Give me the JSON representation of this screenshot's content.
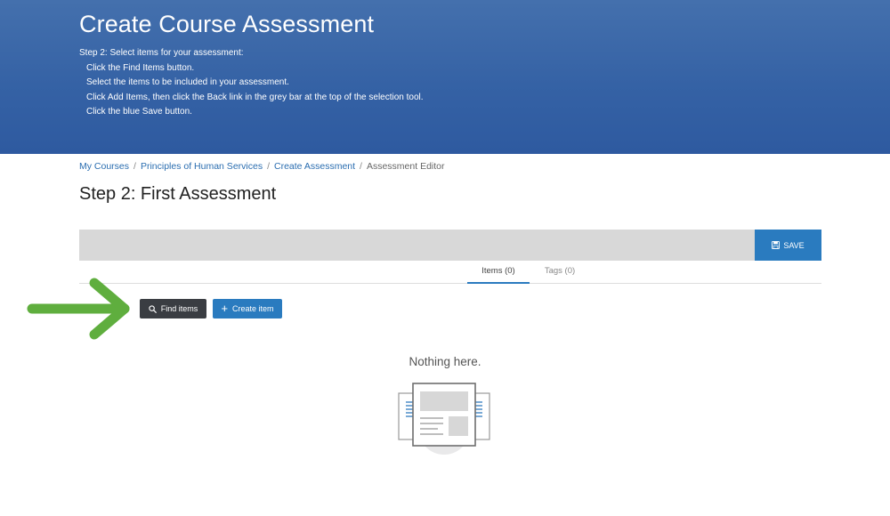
{
  "banner": {
    "title": "Create Course Assessment",
    "intro": "Step 2: Select items for your assessment:",
    "steps": [
      "Click the Find Items button.",
      "Select the items to be included in your assessment.",
      "Click Add Items, then click the Back link in the grey bar at the top of the selection tool.",
      "Click the blue Save button."
    ]
  },
  "breadcrumb": {
    "items": [
      "My Courses",
      "Principles of Human Services",
      "Create Assessment",
      "Assessment Editor"
    ],
    "separator": "/"
  },
  "page": {
    "title": "Step 2: First Assessment"
  },
  "toolbar": {
    "save_label": "SAVE",
    "save_icon": "floppy-disk-icon"
  },
  "tabs": [
    {
      "label": "Items (0)",
      "active": true
    },
    {
      "label": "Tags (0)",
      "active": false
    }
  ],
  "actions": {
    "find_label": "Find items",
    "find_icon": "search-icon",
    "create_label": "Create item",
    "create_icon": "plus-icon"
  },
  "empty_state": {
    "message": "Nothing here.",
    "illustration": "empty-documents-illustration"
  },
  "colors": {
    "banner": "#3562a5",
    "accent": "#2a7bbf",
    "dark_button": "#3a3d42",
    "toolbar": "#d8d8d8",
    "arrow": "#5fae3e"
  }
}
